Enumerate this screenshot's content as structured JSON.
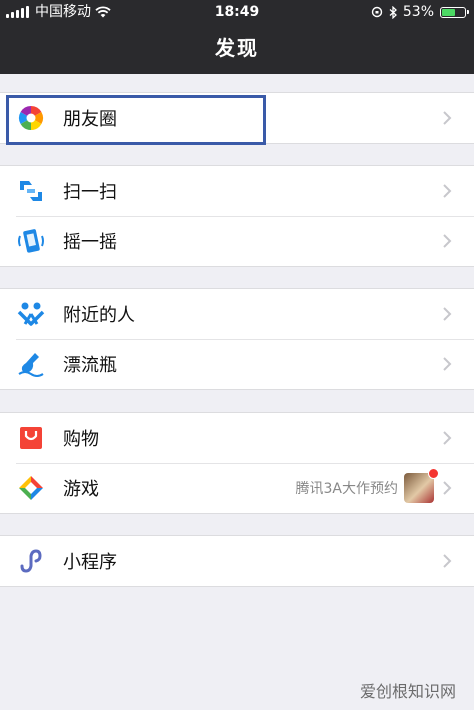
{
  "status": {
    "carrier": "中国移动",
    "time": "18:49",
    "battery_percent": "53%",
    "battery_level": 0.53
  },
  "header": {
    "title": "发现"
  },
  "groups": [
    {
      "items": [
        {
          "label": "朋友圈",
          "icon": "moments-icon"
        }
      ]
    },
    {
      "items": [
        {
          "label": "扫一扫",
          "icon": "scan-icon"
        },
        {
          "label": "摇一摇",
          "icon": "shake-icon"
        }
      ]
    },
    {
      "items": [
        {
          "label": "附近的人",
          "icon": "people-nearby-icon"
        },
        {
          "label": "漂流瓶",
          "icon": "drift-bottle-icon"
        }
      ]
    },
    {
      "items": [
        {
          "label": "购物",
          "icon": "shopping-icon"
        },
        {
          "label": "游戏",
          "icon": "games-icon",
          "subtitle": "腾讯3A大作预约"
        }
      ]
    },
    {
      "items": [
        {
          "label": "小程序",
          "icon": "mini-program-icon"
        }
      ]
    }
  ],
  "watermark": "爱创根知识网",
  "colors": {
    "highlight": "#3a5aa8",
    "nav_bg": "#2a2a2d",
    "badge": "#f43530"
  }
}
